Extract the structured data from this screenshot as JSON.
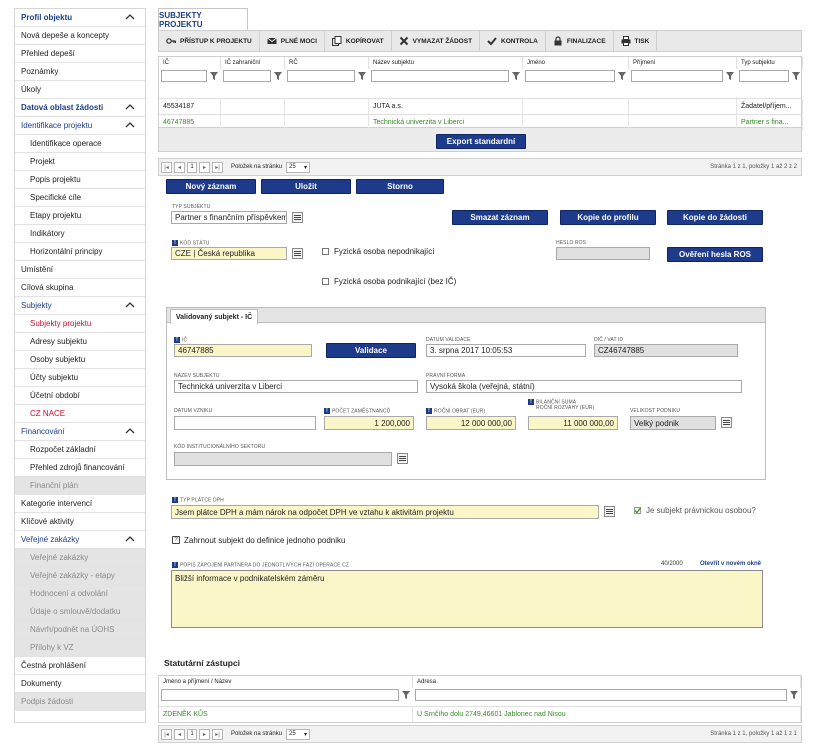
{
  "sidebar": {
    "items": [
      {
        "label": "Profil objektu",
        "level": 1,
        "type": "head",
        "chevron": true
      },
      {
        "label": "Nová depeše a koncepty",
        "level": 1,
        "type": "normal"
      },
      {
        "label": "Přehled depeší",
        "level": 1,
        "type": "normal"
      },
      {
        "label": "Poznámky",
        "level": 1,
        "type": "normal"
      },
      {
        "label": "Úkoly",
        "level": 1,
        "type": "normal"
      },
      {
        "label": "Datová oblast žádosti",
        "level": 1,
        "type": "head",
        "chevron": true
      },
      {
        "label": "Identifikace projektu",
        "level": 1,
        "type": "head-light",
        "chevron": true
      },
      {
        "label": "Identifikace operace",
        "level": 2,
        "type": "normal"
      },
      {
        "label": "Projekt",
        "level": 2,
        "type": "normal"
      },
      {
        "label": "Popis projektu",
        "level": 2,
        "type": "normal"
      },
      {
        "label": "Specifické cíle",
        "level": 2,
        "type": "normal"
      },
      {
        "label": "Etapy projektu",
        "level": 2,
        "type": "normal"
      },
      {
        "label": "Indikátory",
        "level": 2,
        "type": "normal"
      },
      {
        "label": "Horizontální principy",
        "level": 2,
        "type": "normal"
      },
      {
        "label": "Umístění",
        "level": 1,
        "type": "normal"
      },
      {
        "label": "Cílová skupina",
        "level": 1,
        "type": "normal"
      },
      {
        "label": "Subjekty",
        "level": 1,
        "type": "head-light",
        "chevron": true
      },
      {
        "label": "Subjekty projektu",
        "level": 2,
        "type": "active"
      },
      {
        "label": "Adresy subjektu",
        "level": 2,
        "type": "normal"
      },
      {
        "label": "Osoby subjektu",
        "level": 2,
        "type": "normal"
      },
      {
        "label": "Účty subjektu",
        "level": 2,
        "type": "normal"
      },
      {
        "label": "Účetní období",
        "level": 2,
        "type": "normal"
      },
      {
        "label": "CZ NACE",
        "level": 2,
        "type": "red"
      },
      {
        "label": "Financování",
        "level": 1,
        "type": "head-light",
        "chevron": true
      },
      {
        "label": "Rozpočet základní",
        "level": 2,
        "type": "normal"
      },
      {
        "label": "Přehled zdrojů financování",
        "level": 2,
        "type": "normal"
      },
      {
        "label": "Finanční plán",
        "level": 2,
        "type": "disabled"
      },
      {
        "label": "Kategorie intervencí",
        "level": 1,
        "type": "normal"
      },
      {
        "label": "Klíčové aktivity",
        "level": 1,
        "type": "normal"
      },
      {
        "label": "Veřejné zakázky",
        "level": 1,
        "type": "head-light",
        "chevron": true
      },
      {
        "label": "Veřejné zakázky",
        "level": 2,
        "type": "disabled"
      },
      {
        "label": "Veřejné zakázky - etapy",
        "level": 2,
        "type": "disabled"
      },
      {
        "label": "Hodnocení a odvolání",
        "level": 2,
        "type": "disabled"
      },
      {
        "label": "Údaje o smlouvě/dodatku",
        "level": 2,
        "type": "disabled"
      },
      {
        "label": "Návrh/podnět na ÚOHS",
        "level": 2,
        "type": "disabled"
      },
      {
        "label": "Přílohy k VZ",
        "level": 2,
        "type": "disabled"
      },
      {
        "label": "Čestná prohlášení",
        "level": 1,
        "type": "normal"
      },
      {
        "label": "Dokumenty",
        "level": 1,
        "type": "normal"
      },
      {
        "label": "Podpis žádosti",
        "level": 1,
        "type": "disabled"
      }
    ]
  },
  "page": {
    "tab_title": "SUBJEKTY PROJEKTU"
  },
  "toolbar": {
    "buttons": [
      {
        "label": "PŘÍSTUP K PROJEKTU",
        "icon": "key-icon"
      },
      {
        "label": "PLNÉ MOCI",
        "icon": "envelope-icon"
      },
      {
        "label": "KOPÍROVAT",
        "icon": "copy-icon"
      },
      {
        "label": "VYMAZAT ŽÁDOST",
        "icon": "cross-icon"
      },
      {
        "label": "KONTROLA",
        "icon": "check-icon"
      },
      {
        "label": "FINALIZACE",
        "icon": "lock-icon"
      },
      {
        "label": "TISK",
        "icon": "printer-icon"
      }
    ]
  },
  "subjects_table": {
    "columns": [
      "IČ",
      "IČ zahraniční",
      "RČ",
      "Název subjektu",
      "Jméno",
      "Příjmení",
      "Typ subjektu"
    ],
    "rows": [
      [
        "45534187",
        "",
        "",
        "JUTA a.s.",
        "",
        "",
        "Žadatel/příjem..."
      ],
      [
        "46747885",
        "",
        "",
        "Technická univerzita v Liberci",
        "",
        "",
        "Partner s fina..."
      ]
    ],
    "export_label": "Export standardní",
    "pager": {
      "page": "1",
      "per_page_label": "Položek na stránku",
      "per_page": "25",
      "info": "Stránka 1 z 1, položky 1 až 2 z 2"
    }
  },
  "actions": {
    "new": "Nový záznam",
    "save": "Uložit",
    "cancel": "Storno",
    "delete": "Smazat záznam",
    "copy_profile": "Kopie do profilu",
    "copy_request": "Kopie do žádosti",
    "verify_ros": "Ověření hesla ROS",
    "validate": "Validace"
  },
  "form": {
    "typ_subjektu_label": "TYP SUBJEKTU",
    "typ_subjektu": "Partner s finančním příspěvkem",
    "kod_statu_label": "KÓD STÁTU",
    "kod_statu": "CZE | Česká republika",
    "fo_nepodnikajici": "Fyzická osoba nepodnikající",
    "fo_podnikajici": "Fyzická osoba podnikající (bez IČ)",
    "heslo_ros_label": "HESLO ROS",
    "heslo_ros": "",
    "validated_tab": "Validovaný subjekt - IČ",
    "ic_label": "IČ",
    "ic": "46747885",
    "datum_validace_label": "DATUM VALIDACE",
    "datum_validace": "3. srpna 2017 10:05:53",
    "dic_label": "DIČ / VAT ID",
    "dic": "CZ46747885",
    "nazev_label": "NÁZEV SUBJEKTU",
    "nazev": "Technická univerzita v Liberci",
    "pravni_forma_label": "PRÁVNÍ FORMA",
    "pravni_forma": "Vysoká škola (veřejná, státní)",
    "datum_vzniku_label": "DATUM VZNIKU",
    "datum_vzniku": "",
    "pocet_zam_label": "POČET ZAMĚSTNANCŮ",
    "pocet_zam": "1 200,000",
    "rocni_obrat_label": "ROČNÍ OBRAT (EUR)",
    "rocni_obrat": "12 000 000,00",
    "bilancni_label_1": "BILANČNÍ SUMA",
    "bilancni_label_2": "ROČNÍ ROZVAHY (EUR)",
    "bilancni": "11 000 000,00",
    "velikost_label": "VELIKOST PODNIKU",
    "velikost": "Velký podnik",
    "kod_inst_label": "KÓD INSTITUCIONÁLNÍHO SEKTORU",
    "kod_inst": "",
    "typ_platce_label": "TYP PLÁTCE DPH",
    "typ_platce": "Jsem plátce DPH a mám nárok na odpočet DPH ve vztahu k aktivitám projektu",
    "pravnicka": "Je subjekt právnickou osobou?",
    "zahrnout": "Zahrnout subjekt do definice jednoho podniku",
    "popis_label": "POPIS ZAPOJENÍ PARTNERA DO JEDNOTLIVÝCH FÁZÍ OPERACE CZ",
    "popis_count": "40/2000",
    "popis_link": "Otevřít v novém okně",
    "popis": "Bližší informace v podnikatelském záměru"
  },
  "statutory": {
    "title": "Statutární zástupci",
    "columns": [
      "Jméno a příjmení / Název",
      "Adresa"
    ],
    "rows": [
      [
        "ZDENĚK KŮS",
        "U Srnčího dolu 2749,46601 Jablonec nad Nisou"
      ]
    ],
    "pager": {
      "page": "1",
      "per_page_label": "Položek na stránku",
      "per_page": "25",
      "info": "Stránka 1 z 1, položky 1 až 1 z 1"
    }
  }
}
